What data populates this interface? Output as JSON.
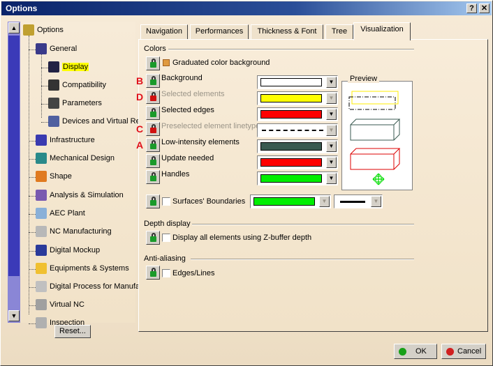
{
  "window": {
    "title": "Options",
    "help_btn": "?",
    "close_btn": "✕"
  },
  "tree": {
    "items": [
      {
        "label": "Options",
        "icon": "options-root-icon",
        "color": "#c0a030"
      },
      {
        "label": "General",
        "icon": "general-icon",
        "color": "#3a3a8a"
      },
      {
        "label": "Display",
        "icon": "display-icon",
        "color": "#222244",
        "selected": true
      },
      {
        "label": "Compatibility",
        "icon": "compatibility-icon",
        "color": "#333333"
      },
      {
        "label": "Parameters",
        "icon": "parameters-icon",
        "color": "#444444"
      },
      {
        "label": "Devices and Virtual Re",
        "icon": "devices-icon",
        "color": "#5060a0"
      },
      {
        "label": "Infrastructure",
        "icon": "infrastructure-icon",
        "color": "#3a3ab0"
      },
      {
        "label": "Mechanical Design",
        "icon": "mechanical-design-icon",
        "color": "#2a8a8a"
      },
      {
        "label": "Shape",
        "icon": "shape-icon",
        "color": "#e07a20"
      },
      {
        "label": "Analysis & Simulation",
        "icon": "analysis-icon",
        "color": "#7a5ab0"
      },
      {
        "label": "AEC Plant",
        "icon": "aec-plant-icon",
        "color": "#8ab0d8"
      },
      {
        "label": "NC Manufacturing",
        "icon": "nc-manufacturing-icon",
        "color": "#b8b8b8"
      },
      {
        "label": "Digital Mockup",
        "icon": "digital-mockup-icon",
        "color": "#2a3a9a"
      },
      {
        "label": "Equipments & Systems",
        "icon": "equipments-icon",
        "color": "#f0c030"
      },
      {
        "label": "Digital Process for Manufa",
        "icon": "digital-process-icon",
        "color": "#c0c0c0"
      },
      {
        "label": "Virtual NC",
        "icon": "virtual-nc-icon",
        "color": "#a0a0a0"
      },
      {
        "label": "Inspection",
        "icon": "inspection-icon",
        "color": "#b0b0b0"
      }
    ],
    "reset_label": "Reset..."
  },
  "tabs": [
    {
      "label": "Navigation"
    },
    {
      "label": "Performances"
    },
    {
      "label": "Thickness & Font"
    },
    {
      "label": "Tree"
    },
    {
      "label": "Visualization",
      "active": true
    }
  ],
  "colors_section": {
    "title": "Colors",
    "graduated": "Graduated color background",
    "rows": [
      {
        "label": "Background",
        "swatch": "#ffffff",
        "letter": "B",
        "lock": "unlocked",
        "enabled": true
      },
      {
        "label": "Selected elements",
        "swatch": "#ffff00",
        "letter": "D",
        "lock": "locked",
        "enabled": false
      },
      {
        "label": "Selected edges",
        "swatch": "#ff0000",
        "letter": "",
        "lock": "unlocked",
        "enabled": true
      },
      {
        "label": "Preselected element linetype",
        "swatch": "linetype",
        "letter": "C",
        "lock": "locked",
        "enabled": false
      },
      {
        "label": "Low-intensity elements",
        "swatch": "#3a5a50",
        "letter": "A",
        "lock": "unlocked",
        "enabled": true
      },
      {
        "label": "Update needed",
        "swatch": "#ff0000",
        "letter": "",
        "lock": "unlocked",
        "enabled": true
      },
      {
        "label": "Handles",
        "swatch": "#00ee00",
        "letter": "",
        "lock": "unlocked",
        "enabled": true
      }
    ],
    "surfaces_label": "Surfaces' Boundaries",
    "surfaces_swatch": "#00ee00",
    "preview_label": "Preview"
  },
  "depth_section": {
    "title": "Depth display",
    "option": "Display all elements using Z-buffer depth"
  },
  "aa_section": {
    "title": "Anti-aliasing",
    "option": "Edges/Lines"
  },
  "buttons": {
    "ok": "OK",
    "cancel": "Cancel"
  },
  "colors": {
    "lock_green": "#1a9a2a",
    "lock_red": "#d01010",
    "ok_dot": "#18a018",
    "cancel_dot": "#d02020"
  }
}
